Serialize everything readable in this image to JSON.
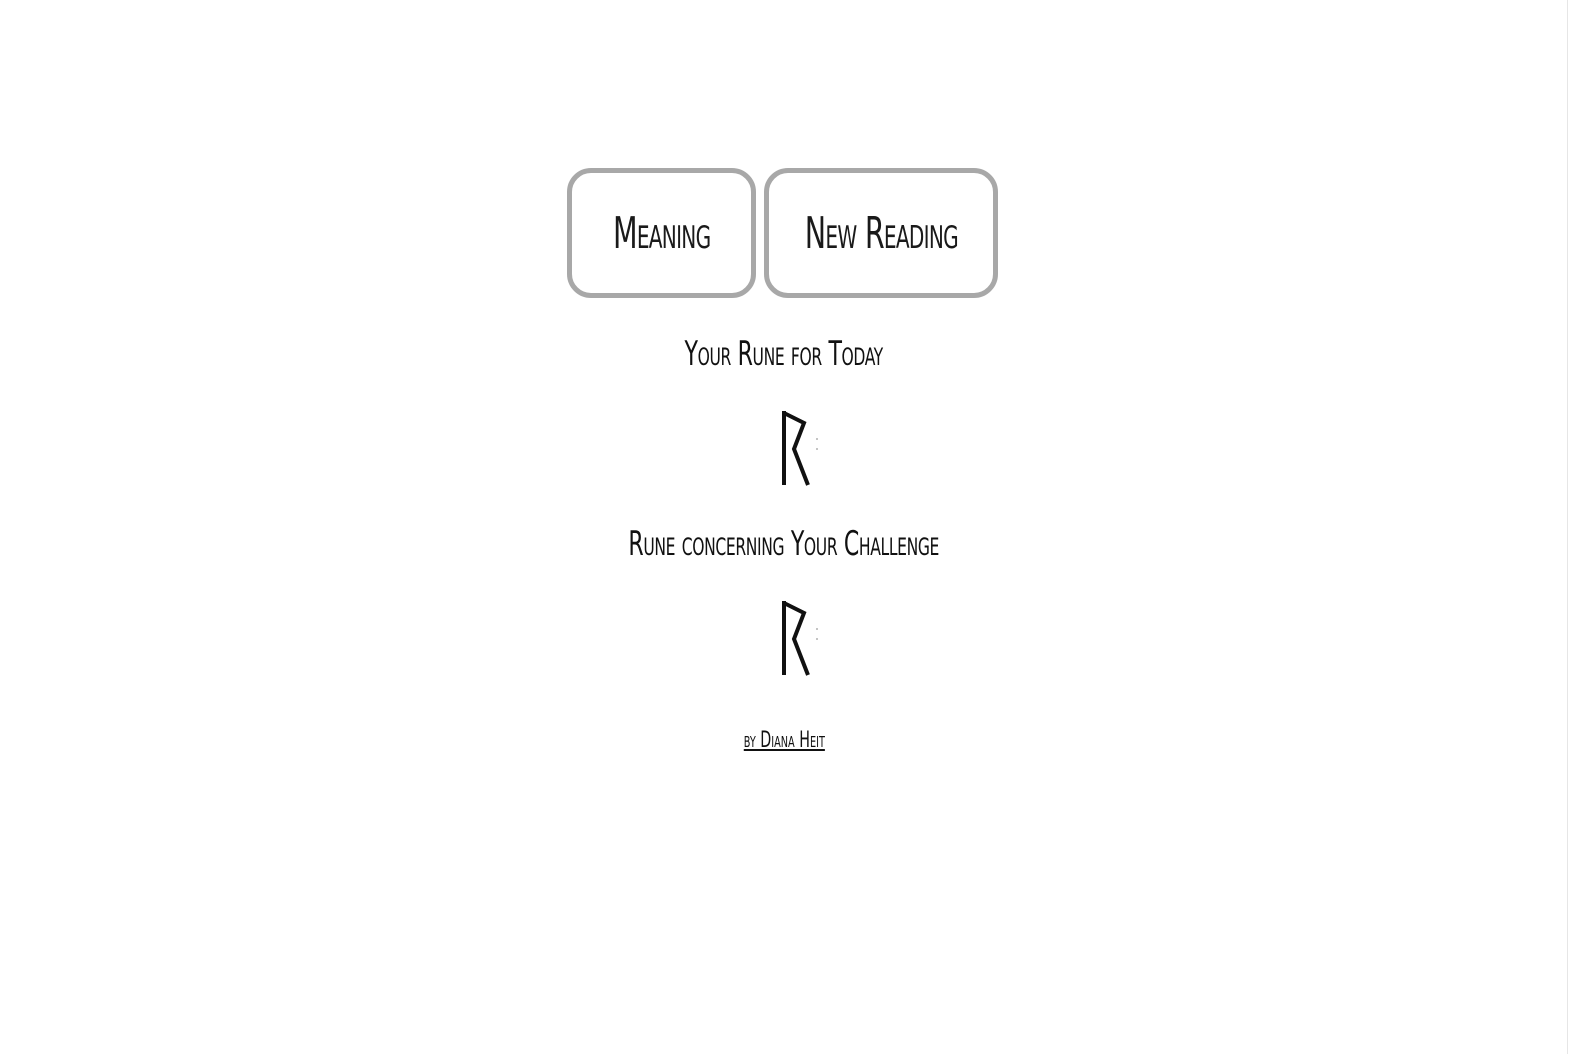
{
  "buttons": {
    "meaning_label": "Meaning",
    "new_reading_label": "New Reading"
  },
  "today": {
    "heading": "Your Rune for Today",
    "rune_icon": "raidho-rune-icon"
  },
  "challenge": {
    "heading": "Rune concerning Your Challenge",
    "rune_icon": "raidho-rune-icon"
  },
  "footer": {
    "credit": "by Diana Heit"
  },
  "colors": {
    "button_border": "#a8a8a8",
    "text": "#111111",
    "background": "#ffffff"
  }
}
